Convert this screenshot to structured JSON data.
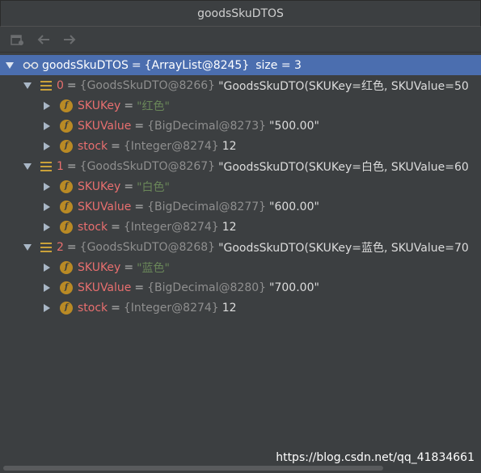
{
  "window": {
    "title": "goodsSkuDTOS"
  },
  "toolbar": {
    "icons": [
      "restore-layout-icon",
      "arrow-left-icon",
      "arrow-right-icon"
    ]
  },
  "root": {
    "name": "goodsSkuDTOS",
    "eq": "=",
    "type": "{ArrayList@8245}",
    "size": "size = 3"
  },
  "items": [
    {
      "index": "0",
      "eq": "=",
      "type": "{GoodsSkuDTO@8266}",
      "value": "\"GoodsSkuDTO(SKUKey=红色, SKUValue=50",
      "fields": [
        {
          "name": "SKUKey",
          "eq": "=",
          "type": "",
          "value": "\"红色\""
        },
        {
          "name": "SKUValue",
          "eq": "=",
          "type": "{BigDecimal@8273}",
          "value": "\"500.00\""
        },
        {
          "name": "stock",
          "eq": "=",
          "type": "{Integer@8274}",
          "value": "12"
        }
      ]
    },
    {
      "index": "1",
      "eq": "=",
      "type": "{GoodsSkuDTO@8267}",
      "value": "\"GoodsSkuDTO(SKUKey=白色, SKUValue=60",
      "fields": [
        {
          "name": "SKUKey",
          "eq": "=",
          "type": "",
          "value": "\"白色\""
        },
        {
          "name": "SKUValue",
          "eq": "=",
          "type": "{BigDecimal@8277}",
          "value": "\"600.00\""
        },
        {
          "name": "stock",
          "eq": "=",
          "type": "{Integer@8274}",
          "value": "12"
        }
      ]
    },
    {
      "index": "2",
      "eq": "=",
      "type": "{GoodsSkuDTO@8268}",
      "value": "\"GoodsSkuDTO(SKUKey=蓝色, SKUValue=70",
      "fields": [
        {
          "name": "SKUKey",
          "eq": "=",
          "type": "",
          "value": "\"蓝色\""
        },
        {
          "name": "SKUValue",
          "eq": "=",
          "type": "{BigDecimal@8280}",
          "value": "\"700.00\""
        },
        {
          "name": "stock",
          "eq": "=",
          "type": "{Integer@8274}",
          "value": "12"
        }
      ]
    }
  ],
  "watermark": "https://blog.csdn.net/qq_41834661",
  "colors": {
    "selection": "#4b6eaf",
    "field_name": "#e86f6f",
    "string_value": "#6a8759",
    "field_icon": "#b98a25"
  }
}
